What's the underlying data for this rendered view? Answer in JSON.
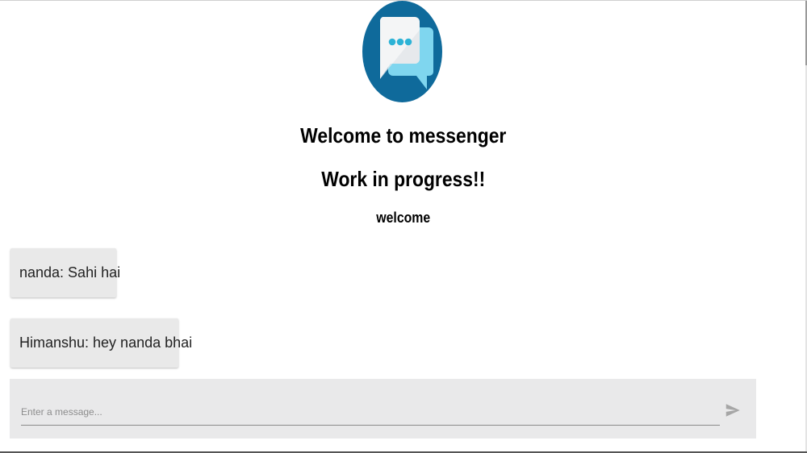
{
  "header": {
    "logo_icon": "chat-bubbles-icon",
    "title": "Welcome to messenger",
    "subtitle": "Work in progress!!",
    "greeting": "welcome"
  },
  "messages": [
    {
      "text": "nanda: Sahi hai"
    },
    {
      "text": "Himanshu: hey nanda bhai"
    }
  ],
  "composer": {
    "placeholder": "Enter a message...",
    "value": "",
    "send_icon": "send-icon"
  },
  "colors": {
    "logo_circle": "#0f6a9b",
    "bubble_front": "#f4f5f6",
    "bubble_back": "#7fd6ef",
    "dots": "#2db3d6",
    "message_bg": "#e9e9e9",
    "composer_bg": "#e9e9ea"
  }
}
